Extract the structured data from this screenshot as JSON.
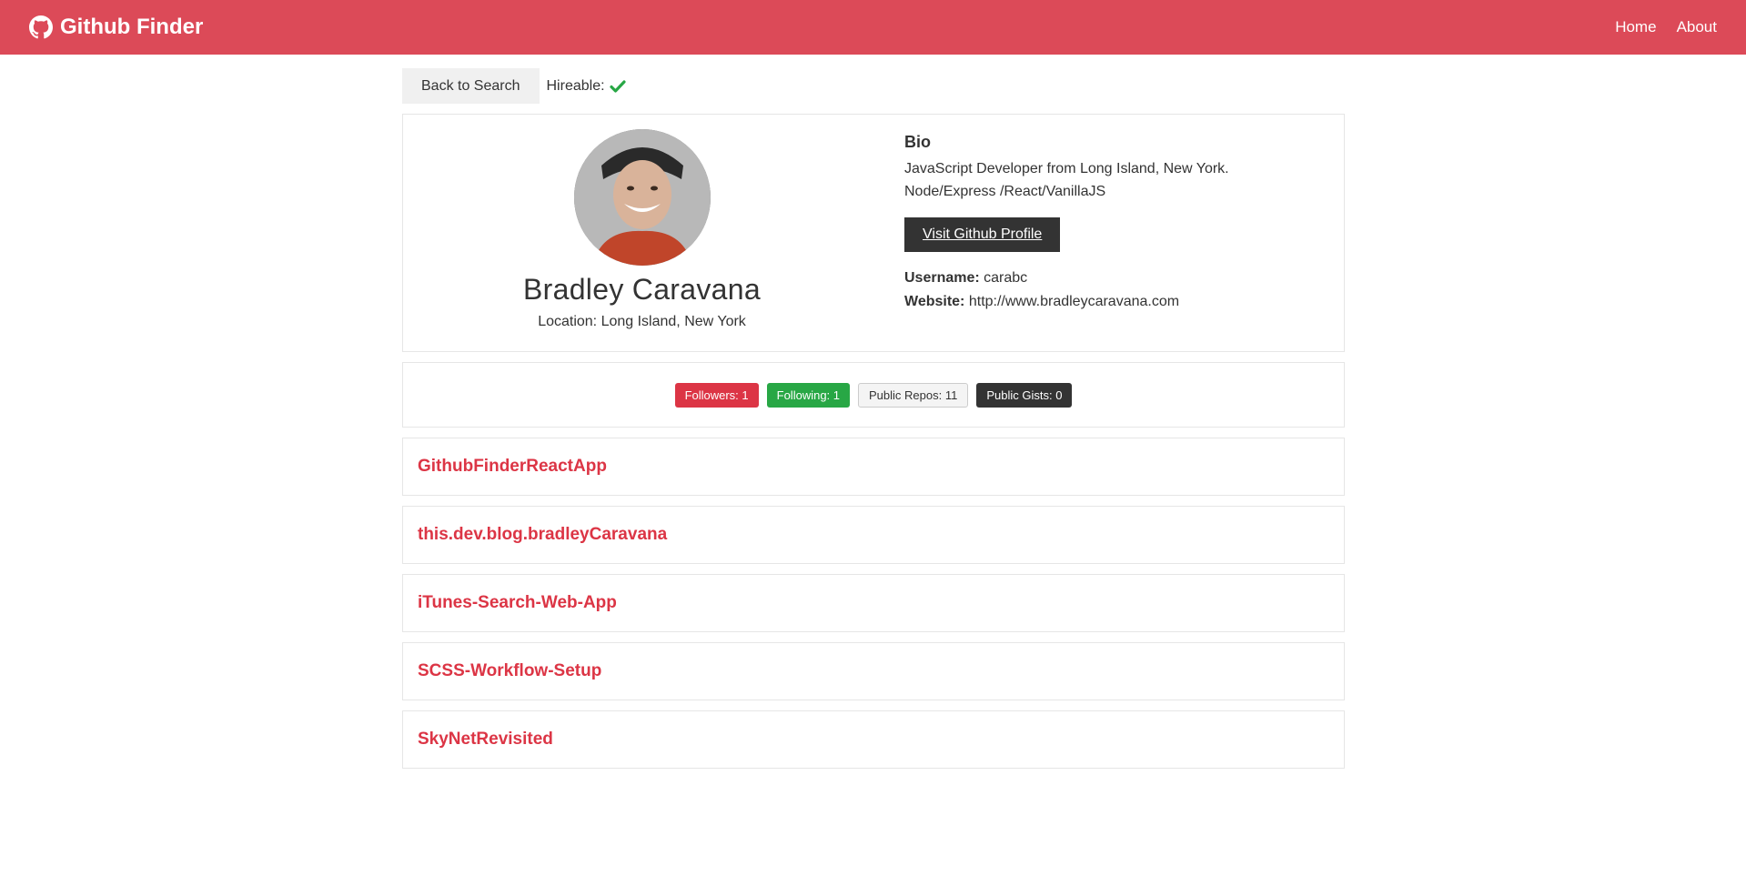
{
  "nav": {
    "brand": "Github Finder",
    "links": [
      "Home",
      "About"
    ]
  },
  "topbar": {
    "back_label": "Back to Search",
    "hireable_label": "Hireable:"
  },
  "profile": {
    "name": "Bradley Caravana",
    "location": "Location: Long Island, New York",
    "bio_heading": "Bio",
    "bio": "JavaScript Developer from Long Island, New York. Node/Express /React/VanillaJS",
    "visit_label": "Visit Github Profile",
    "username_label": "Username:",
    "username": "carabc",
    "website_label": "Website:",
    "website": "http://www.bradleycaravana.com"
  },
  "stats": {
    "followers": "Followers: 1",
    "following": "Following: 1",
    "repos": "Public Repos: 11",
    "gists": "Public Gists: 0"
  },
  "repos": [
    "GithubFinderReactApp",
    "this.dev.blog.bradleyCaravana",
    "iTunes-Search-Web-App",
    "SCSS-Workflow-Setup",
    "SkyNetRevisited"
  ],
  "colors": {
    "navbar": "#dc4a58",
    "accent_red": "#dc3545",
    "green": "#28a745",
    "dark": "#333333"
  },
  "icons": {
    "brand": "github-icon",
    "hireable": "check-icon"
  }
}
